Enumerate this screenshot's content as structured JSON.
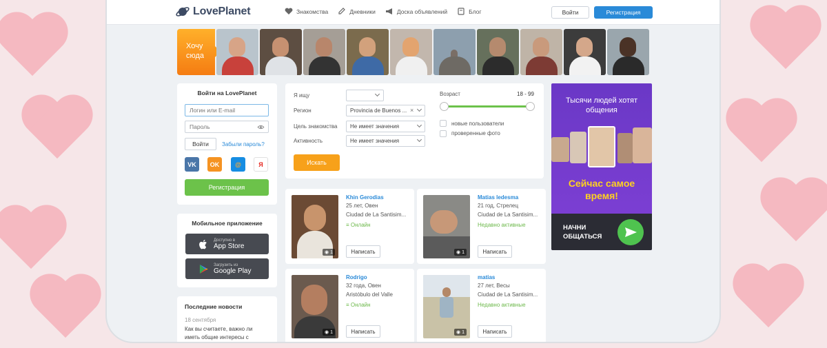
{
  "brand": {
    "name": "LovePlanet"
  },
  "nav": [
    {
      "label": "Знакомства",
      "icon": "heart-icon"
    },
    {
      "label": "Дневники",
      "icon": "pencil-icon"
    },
    {
      "label": "Доска объявлений",
      "icon": "megaphone-icon"
    },
    {
      "label": "Блог",
      "icon": "book-icon"
    }
  ],
  "header": {
    "login_label": "Войти",
    "register_label": "Регистрация"
  },
  "promo": {
    "want_here": "Хочу сюда"
  },
  "login": {
    "title": "Войти на LovePlanet",
    "login_placeholder": "Логин или E-mail",
    "password_placeholder": "Пароль",
    "submit_label": "Войти",
    "forgot_label": "Забыли пароль?",
    "socials": [
      "VK",
      "OK",
      "@",
      "Я"
    ],
    "register_label": "Регистрация"
  },
  "mobile": {
    "title": "Мобильное приложение",
    "appstore_small": "Доступно в",
    "appstore_big": "App Store",
    "gplay_small": "Загрузить из",
    "gplay_big": "Google Play"
  },
  "news": {
    "title": "Последние новости",
    "date": "18 сентября",
    "text": "Как вы считаете, важно ли иметь общие интересы с"
  },
  "search": {
    "seeking_label": "Я ищу",
    "seeking_value": "",
    "region_label": "Регион",
    "region_value": "Provincia de Buenos ...",
    "goal_label": "Цель знакомства",
    "goal_value": "Не имеет значения",
    "activity_label": "Активность",
    "activity_value": "Не имеет значения",
    "age_label": "Возраст",
    "age_range": "18 - 99",
    "new_users_label": "новые пользователи",
    "verified_label": "проверенные фото",
    "submit_label": "Искать"
  },
  "profiles": [
    {
      "name": "Khin Gerodias",
      "age": "25 лет, Овен",
      "city": "Ciudad de La Santisim...",
      "status": "Онлайн",
      "photos": "1",
      "write": "Написать"
    },
    {
      "name": "Matias ledesma",
      "age": "21 год, Стрелец",
      "city": "Ciudad de La Santisim...",
      "status": "Недавно активные",
      "photos": "1",
      "write": "Написать"
    },
    {
      "name": "Rodrigo",
      "age": "32 года, Овен",
      "city": "Aristóbulo del Valle",
      "status": "Онлайн",
      "photos": "1",
      "write": "Написать"
    },
    {
      "name": "matias",
      "age": "27 лет, Весы",
      "city": "Ciudad de La Santisim...",
      "status": "Недавно активные",
      "photos": "1",
      "write": "Написать"
    }
  ],
  "ad": {
    "title": "Тысячи людей хотят общения",
    "headline": "Сейчас самое время!",
    "cta": "НАЧНИ ОБЩАТЬСЯ"
  },
  "colors": {
    "accent": "#2a8ad8",
    "green": "#6cc24a",
    "orange": "#f7a11a",
    "ad_purple": "#7a3fd2"
  }
}
